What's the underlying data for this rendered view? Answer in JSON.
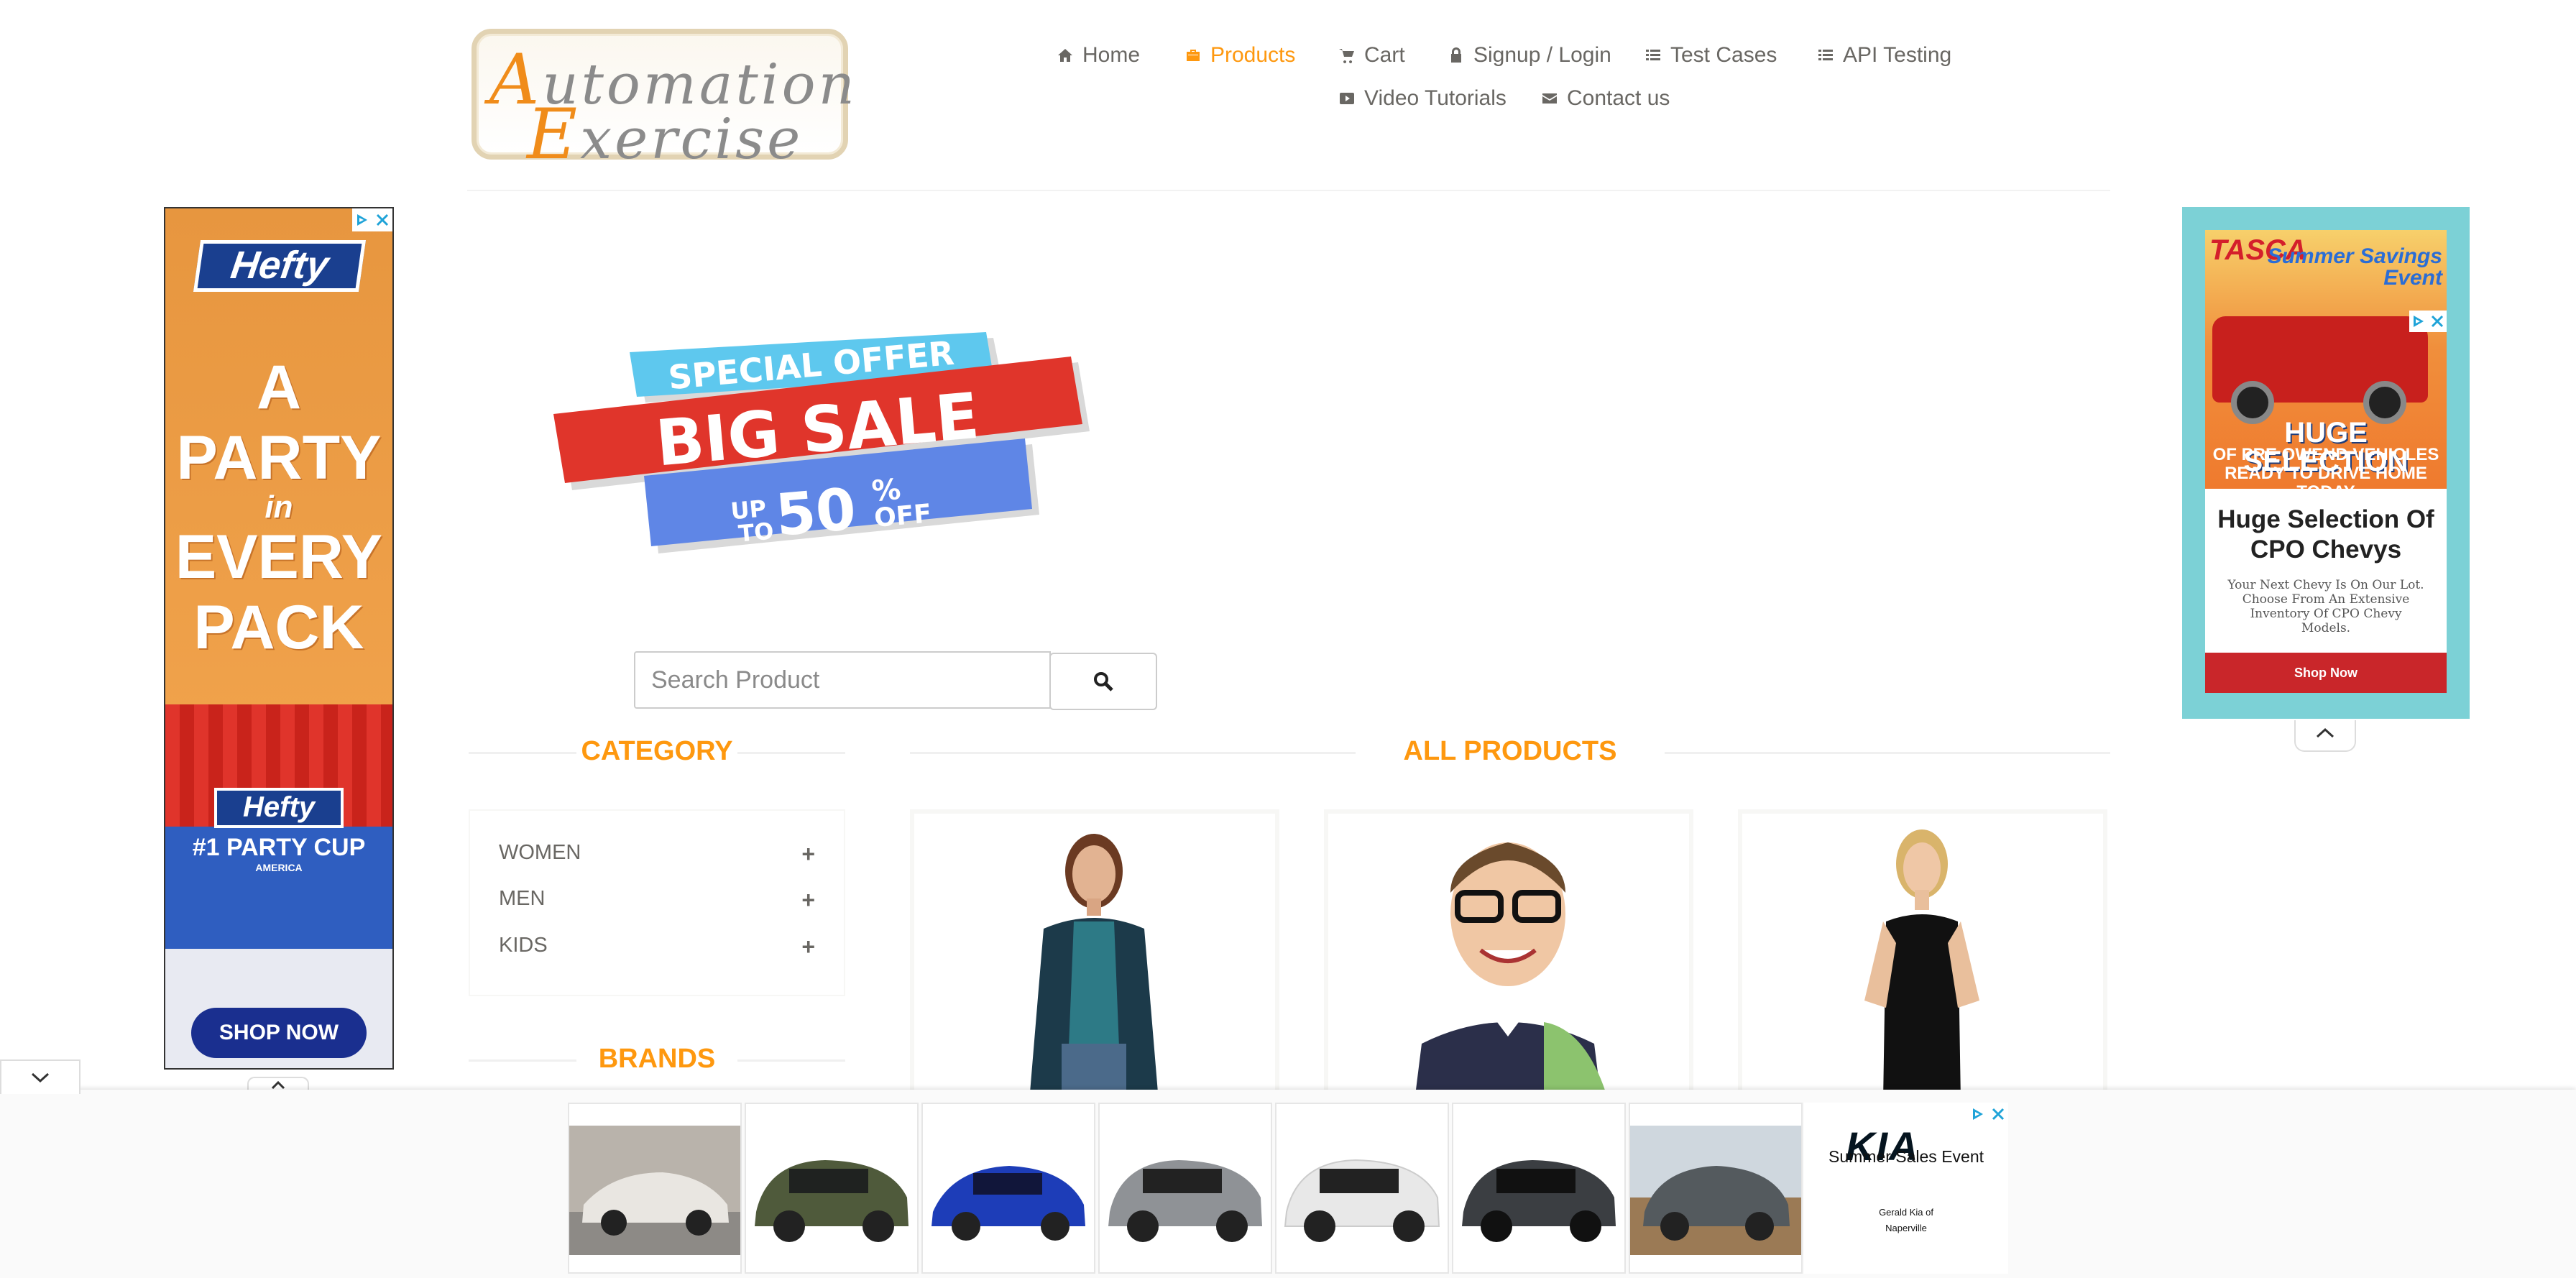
{
  "header": {
    "logo_line1": "utomation",
    "logo_line1_cap": "A",
    "logo_line2": "xercise",
    "logo_line2_cap": "E",
    "nav": {
      "home": "Home",
      "products": "Products",
      "cart": "Cart",
      "signup": "Signup / Login",
      "test_cases": "Test Cases",
      "api_testing": "API Testing",
      "video_tutorials": "Video Tutorials",
      "contact": "Contact us"
    },
    "active": "Products"
  },
  "banner": {
    "line1": "SPECIAL OFFER",
    "line2": "BIG SALE",
    "line3_up": "UP",
    "line3_to": "TO",
    "line3_value": "50",
    "line3_pct": "%",
    "line3_off": "OFF"
  },
  "search": {
    "placeholder": "Search Product",
    "value": ""
  },
  "sidebar": {
    "category_title": "CATEGORY",
    "categories": [
      "WOMEN",
      "MEN",
      "KIDS"
    ],
    "brands_title": "BRANDS"
  },
  "main": {
    "title": "ALL PRODUCTS"
  },
  "ad_left": {
    "brand": "Hefty",
    "headline_1": "A",
    "headline_2": "PARTY",
    "headline_3": "in",
    "headline_4": "EVERY",
    "headline_5": "PACK",
    "product": "#1 PARTY CUP",
    "product_sub": "AMERICA",
    "cta": "SHOP NOW"
  },
  "ad_right": {
    "dealer": "TASCA",
    "event": "Summer Savings Event",
    "headline": "HUGE SELECTION",
    "sub": "OF PRE OWEND VEHICLES READY TO DRIVE HOME TODAY",
    "title": "Huge Selection Of CPO Chevys",
    "body": "Your Next Chevy Is On Our Lot. Choose From An Extensive Inventory Of CPO Chevy Models.",
    "cta": "Shop Now"
  },
  "ad_bottom": {
    "brand": "KIA",
    "title": "Summer Sales Event",
    "dealer": "Gerald Kia of Naperville"
  },
  "colors": {
    "accent": "#FE980F",
    "text": "#696763"
  },
  "icons": [
    "home-icon",
    "products-icon",
    "cart-icon",
    "lock-icon",
    "list-icon",
    "video-icon",
    "envelope-icon",
    "search-icon",
    "plus-icon",
    "chevron-up-icon",
    "chevron-down-icon",
    "adchoices-icon",
    "close-icon"
  ]
}
